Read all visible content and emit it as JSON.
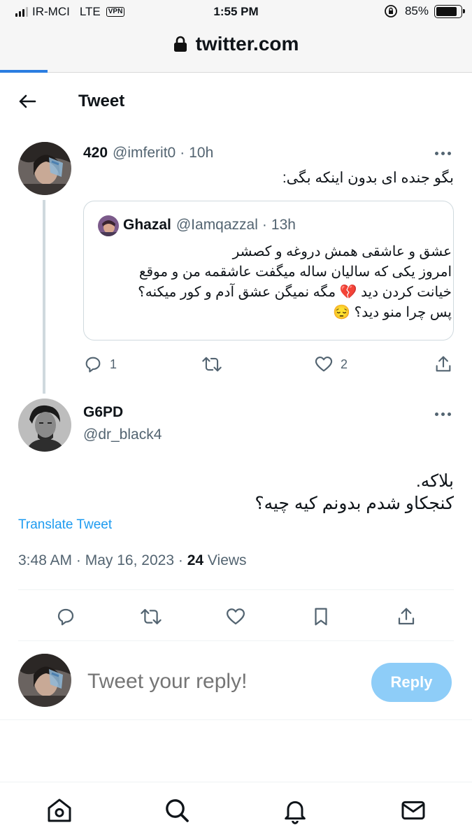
{
  "status_bar": {
    "carrier": "IR-MCI",
    "network": "LTE",
    "vpn": "VPN",
    "time": "1:55 PM",
    "battery": "85%",
    "battery_level": 0.85
  },
  "browser": {
    "domain": "twitter.com",
    "load_progress": 0.1
  },
  "header": {
    "title": "Tweet",
    "back_icon": "arrow-left-icon"
  },
  "parent_tweet": {
    "name": "420",
    "handle": "@imferit0",
    "sep": "·",
    "age": "10h",
    "text": "بگو جنده ای بدون اینکه بگی:",
    "quote": {
      "name": "Ghazal",
      "handle": "@Iamqazzal",
      "sep": "·",
      "age": "13h",
      "lines": [
        "عشق و عاشقی همش دروغه و کصشر",
        "امروز یکی که سالیان ساله میگفت عاشقمه من و موقع",
        "خیانت کردن دید 💔 مگه نمیگن عشق آدم و کور میکنه؟",
        "پس چرا منو دید؟ 😔"
      ]
    },
    "actions": {
      "replies": "1",
      "retweets": "",
      "likes": "2"
    }
  },
  "main_tweet": {
    "name": "G6PD",
    "handle": "@dr_black4",
    "lines": [
      "بلاکه.",
      "کنجکاو شدم بدونم کیه چیه؟"
    ],
    "translate": "Translate Tweet",
    "time": "3:48 AM",
    "sep": "·",
    "date": "May 16, 2023",
    "sep2": "·",
    "views_count": "24",
    "views_label": "Views"
  },
  "reply_box": {
    "placeholder": "Tweet your reply!",
    "button": "Reply"
  },
  "colors": {
    "accent": "#1d9bf0",
    "reply_button": "#8ecdf8",
    "muted": "#536471",
    "border": "#cfd9de"
  }
}
